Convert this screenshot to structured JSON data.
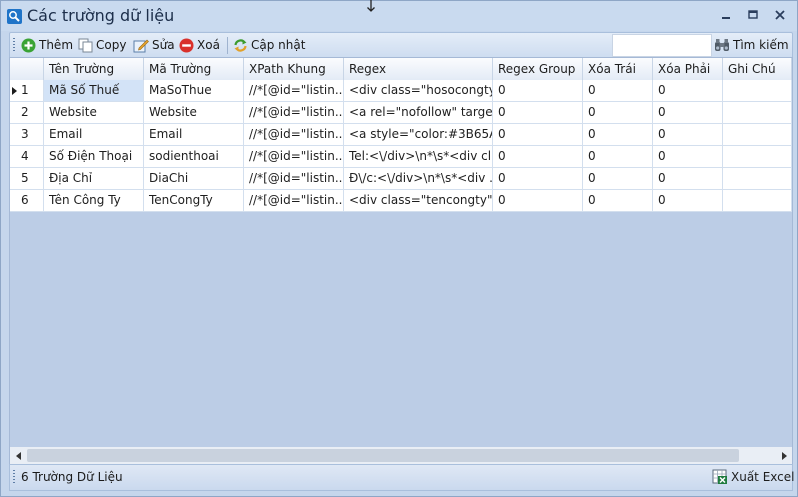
{
  "window": {
    "title": "Các trường dữ liệu"
  },
  "toolbar": {
    "add_label": "Thêm",
    "copy_label": "Copy",
    "edit_label": "Sửa",
    "delete_label": "Xoá",
    "update_label": "Cập nhật",
    "search_value": "",
    "search_label": "Tìm kiếm"
  },
  "table": {
    "columns": [
      "Tên Trường",
      "Mã Trường",
      "XPath Khung",
      "Regex",
      "Regex Group",
      "Xóa Trái",
      "Xóa Phải",
      "Ghi Chú"
    ],
    "rows": [
      {
        "num": "1",
        "cells": [
          "Mã Số Thuế",
          "MaSoThue",
          "//*[@id=\"listin...",
          "<div class=\"hosocongty...",
          "0",
          "0",
          "0",
          ""
        ]
      },
      {
        "num": "2",
        "cells": [
          "Website",
          "Website",
          "//*[@id=\"listin...",
          "<a rel=\"nofollow\" target...",
          "0",
          "0",
          "0",
          ""
        ]
      },
      {
        "num": "3",
        "cells": [
          "Email",
          "Email",
          "//*[@id=\"listin...",
          "<a style=\"color:#3B65A...",
          "0",
          "0",
          "0",
          ""
        ]
      },
      {
        "num": "4",
        "cells": [
          "Số Điện Thoại",
          "sodienthoai",
          "//*[@id=\"listin...",
          "Tel:<\\/div>\\n*\\s*<div cl...",
          "0",
          "0",
          "0",
          ""
        ]
      },
      {
        "num": "5",
        "cells": [
          "Địa Chỉ",
          "DiaChi",
          "//*[@id=\"listin...",
          "Đ\\/c:<\\/div>\\n*\\s*<div ...",
          "0",
          "0",
          "0",
          ""
        ]
      },
      {
        "num": "6",
        "cells": [
          "Tên Công Ty",
          "TenCongTy",
          "//*[@id=\"listin...",
          "<div class=\"tencongty\"...",
          "0",
          "0",
          "0",
          ""
        ]
      }
    ],
    "selected_row": 0
  },
  "status": {
    "count_text": "6 Trường Dữ Liệu",
    "export_label": "Xuất Excel"
  },
  "colors": {
    "selected_cell": "#d3e3f7",
    "window_bg": "#c5d6ec"
  }
}
